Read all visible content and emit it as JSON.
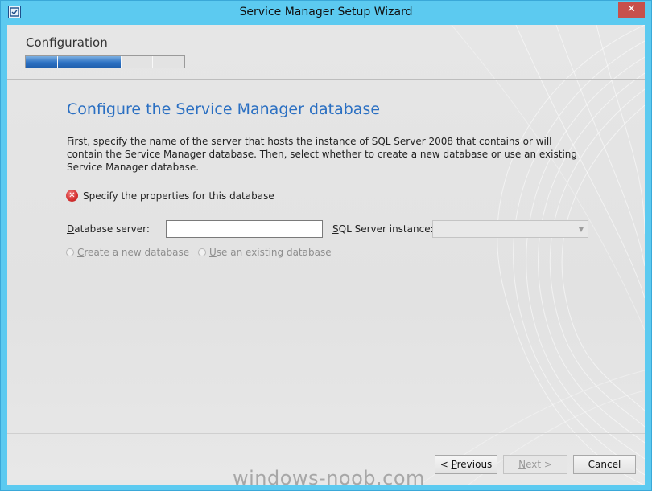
{
  "window": {
    "title": "Service Manager Setup Wizard",
    "close_glyph": "✕"
  },
  "header": {
    "step_title": "Configuration",
    "progress": {
      "total_steps": 5,
      "completed_steps": 3
    }
  },
  "main": {
    "heading": "Configure the Service Manager database",
    "intro": "First, specify the name of the server that hosts the instance of SQL Server 2008 that contains or will contain the Service Manager database. Then, select whether to create a new database or use an existing Service Manager database.",
    "error_text": "Specify the properties for this database",
    "database_server": {
      "label_access": "D",
      "label_rest": "atabase server:",
      "value": ""
    },
    "sql_instance": {
      "label_access": "S",
      "label_rest": "QL Server instance:",
      "value": ""
    },
    "radio_create": {
      "label_access": "C",
      "label_rest": "reate a new database"
    },
    "radio_existing": {
      "label_access": "U",
      "label_rest": "se an existing database"
    }
  },
  "footer": {
    "previous_prefix": "< ",
    "previous_access": "P",
    "previous_rest": "revious",
    "next_access": "N",
    "next_rest": "ext >",
    "cancel": "Cancel"
  },
  "watermark": "windows-noob.com",
  "colors": {
    "accent": "#2a6fc2",
    "titlebar": "#5ccaf0",
    "close": "#c7504b",
    "progress_done": "#2f73c4"
  },
  "icons": {
    "app": "wizard-app-icon",
    "error": "error-icon",
    "dropdown": "chevron-down-icon"
  }
}
